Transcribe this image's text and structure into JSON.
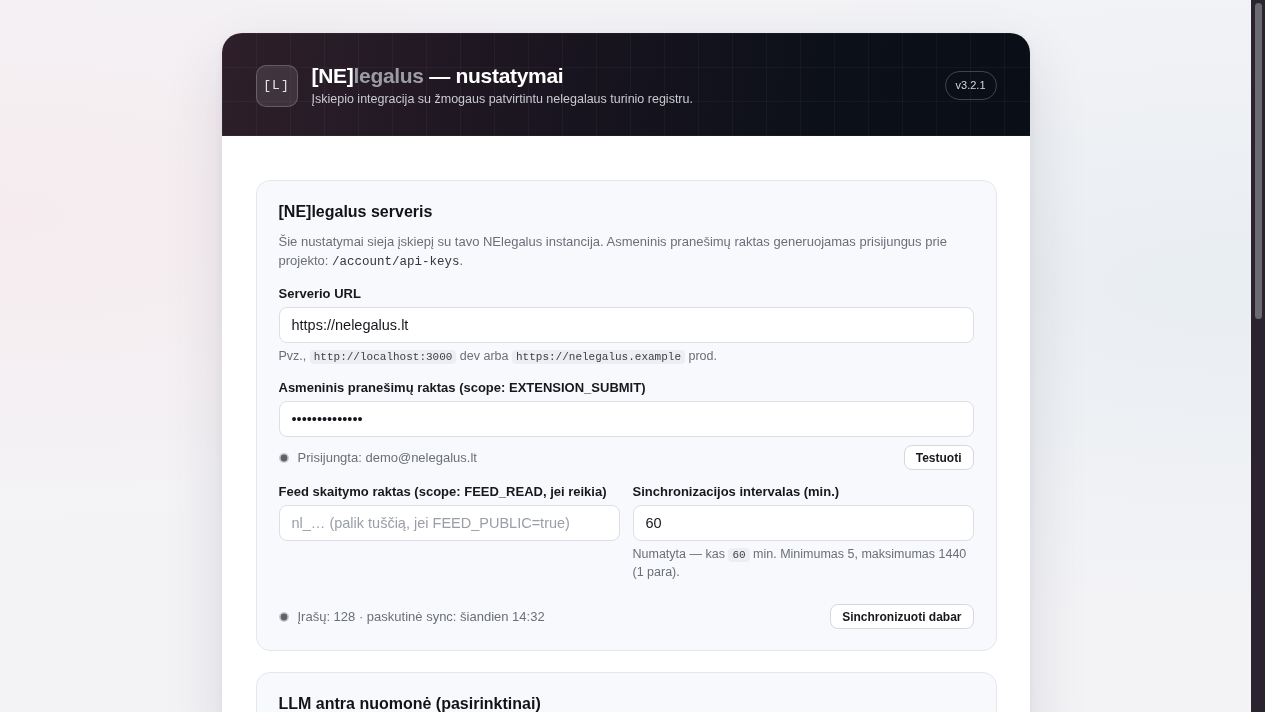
{
  "header": {
    "logo": "[L]",
    "title": {
      "bracket": "[NE]",
      "muted": "legalus",
      "rest": " — nustatymai"
    },
    "subtitle": "Įskiepio integracija su žmogaus patvirtintu nelegalaus turinio registru.",
    "version": "v3.2.1"
  },
  "sections": [
    {
      "title": "[NE]legalus serveris",
      "description": [
        {
          "kind": "text",
          "text": "Šie nustatymai sieja įskiepį su tavo NElegalus instancija. Asmeninis pranešimų raktas generuojamas prisijungus prie projekto: "
        },
        {
          "kind": "code",
          "text": "/account/api-keys"
        },
        {
          "kind": "text",
          "text": "."
        }
      ],
      "items": [
        {
          "kind": "field",
          "label": "Serverio URL",
          "value": "https://nelegalus.lt",
          "hint": [
            {
              "kind": "text",
              "text": "Pvz., "
            },
            {
              "kind": "code",
              "text": "http://localhost:3000"
            },
            {
              "kind": "text",
              "text": " dev arba "
            },
            {
              "kind": "code",
              "text": "https://nelegalus.example"
            },
            {
              "kind": "text",
              "text": " prod."
            }
          ]
        },
        {
          "kind": "field",
          "label": "Asmeninis pranešimų raktas (scope: EXTENSION_SUBMIT)",
          "value": "••••••••••••••"
        },
        {
          "kind": "status",
          "text": "Prisijungta: demo@nelegalus.lt",
          "button": "Testuoti"
        },
        {
          "kind": "columns",
          "fields": [
            {
              "label": "Feed skaitymo raktas (scope: FEED_READ, jei reikia)",
              "placeholder": "nl_… (palik tuščią, jei FEED_PUBLIC=true)"
            },
            {
              "label": "Sinchronizacijos intervalas (min.)",
              "value": "60",
              "hint": [
                {
                  "kind": "text",
                  "text": "Numatyta — kas "
                },
                {
                  "kind": "code",
                  "text": "60"
                },
                {
                  "kind": "text",
                  "text": " min. Minimumas 5, maksimumas 1440 (1 para)."
                }
              ]
            }
          ]
        },
        {
          "kind": "status",
          "text": "Įrašų: 128 · paskutinė sync: šiandien 14:32",
          "button": "Sinchronizuoti dabar"
        }
      ]
    },
    {
      "title": "LLM antra nuomonė (pasirinktinai)"
    }
  ]
}
